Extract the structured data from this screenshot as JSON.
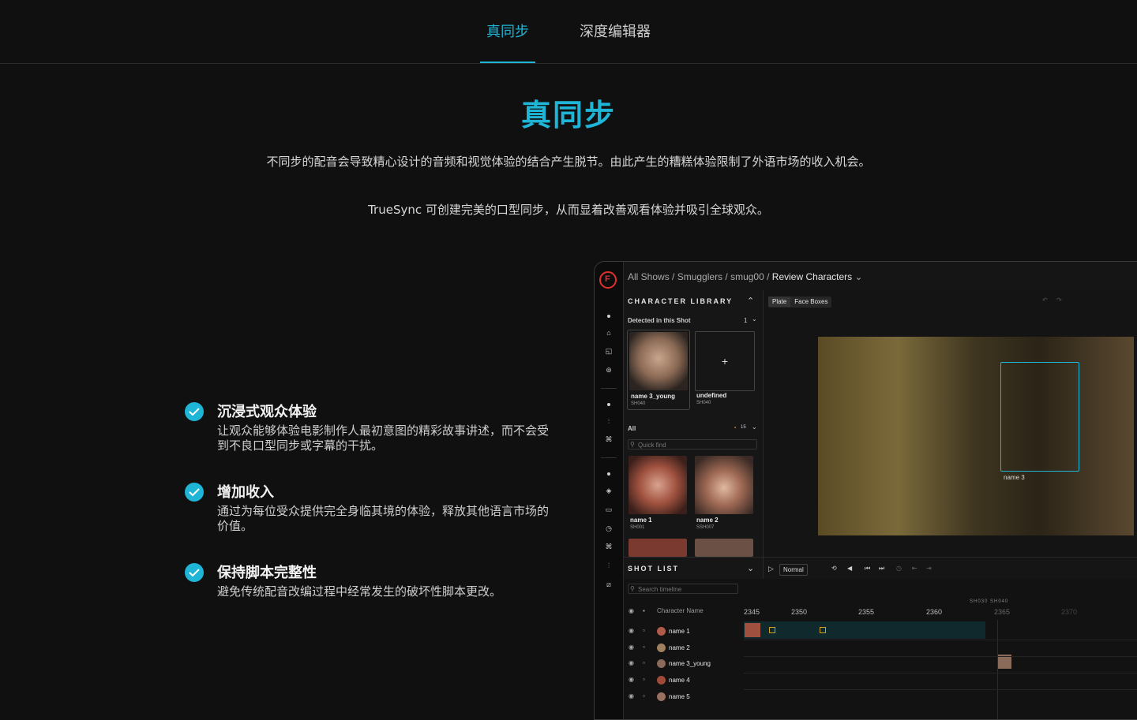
{
  "nav": {
    "tabs": [
      "真同步",
      "深度编辑器"
    ]
  },
  "hero": {
    "title": "真同步",
    "p1": "不同步的配音会导致精心设计的音频和视觉体验的结合产生脱节。由此产生的糟糕体验限制了外语市场的收入机会。",
    "p2": "TrueSync 可创建完美的口型同步，从而显着改善观看体验并吸引全球观众。"
  },
  "features": [
    {
      "title": "沉浸式观众体验",
      "desc": "让观众能够体验电影制作人最初意图的精彩故事讲述，而不会受到不良口型同步或字幕的干扰。"
    },
    {
      "title": "增加收入",
      "desc": "通过为每位受众提供完全身临其境的体验，释放其他语言市场的价值。"
    },
    {
      "title": "保持脚本完整性",
      "desc": "避免传统配音改编过程中经常发生的破坏性脚本更改。"
    }
  ],
  "app": {
    "breadcrumb": [
      "All Shows",
      "Smugglers",
      "smug00",
      "Review Characters"
    ],
    "library": {
      "title": "CHARACTER LIBRARY",
      "detected_label": "Detected in this Shot",
      "detected_count": "1",
      "detected": [
        {
          "name": "name 3_young",
          "shot": "SH040"
        },
        {
          "name": "undefined",
          "shot": "SH040"
        }
      ],
      "add_symbol": "+",
      "all_label": "All",
      "all_count": "15",
      "quick_find_placeholder": "Quick find",
      "all": [
        {
          "name": "name 1",
          "shot": "SH001"
        },
        {
          "name": "name 2",
          "shot": "SSH007"
        }
      ]
    },
    "viewer": {
      "tabs": [
        "Plate",
        "Face Boxes"
      ],
      "face_label": "name 3"
    },
    "controls": {
      "speed": "Normal"
    },
    "shot_list": {
      "title": "SHOT LIST",
      "search_placeholder": "Search timeline",
      "column": "Character Name",
      "rows": [
        "name 1",
        "name 2",
        "name 3_young",
        "name 4",
        "name 5"
      ],
      "shots": "SH030  SH040",
      "ticks": [
        "2345",
        "2350",
        "2355",
        "2360",
        "2365",
        "2370"
      ]
    },
    "colors": {
      "accent": "#1fb5d6",
      "brand": "#e0312a"
    }
  }
}
